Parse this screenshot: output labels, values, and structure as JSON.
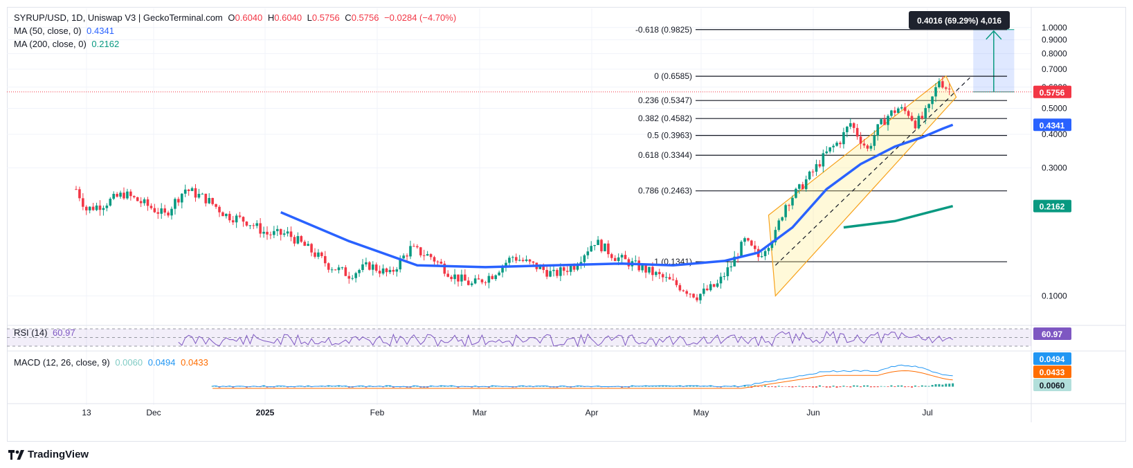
{
  "header": {
    "symbol": "SYRUP/USD, 1D, Uniswap V3 | GeckoTerminal.com",
    "o_label": "O",
    "o": "0.6040",
    "h_label": "H",
    "h": "0.6040",
    "l_label": "L",
    "l": "0.5756",
    "c_label": "C",
    "c": "0.5756",
    "change": "−0.0284 (−4.70%)"
  },
  "ma50": {
    "label": "MA (50, close, 0)",
    "value": "0.4341"
  },
  "ma200": {
    "label": "MA (200, close, 0)",
    "value": "0.2162"
  },
  "rsi": {
    "label": "RSI (14)",
    "value": "60.97"
  },
  "macd": {
    "label": "MACD (12, 26, close, 9)",
    "hist": "0.0060",
    "macd": "0.0494",
    "signal": "0.0433"
  },
  "measure_tooltip": "0.4016 (69.29%) 4,016",
  "brand": "TradingView",
  "colors": {
    "up": "#089981",
    "down": "#f23645",
    "ma50": "#2962ff",
    "ma200": "#089981",
    "rsi": "#7e57c2",
    "macd_line": "#2196f3",
    "signal_line": "#ff6d00",
    "channel": "#f7a21b"
  },
  "chart_data": {
    "type": "candlestick",
    "title": "SYRUP/USD, 1D, Uniswap V3",
    "x_ticks": [
      "13",
      "Dec",
      "2025",
      "Feb",
      "Mar",
      "Apr",
      "May",
      "Jun",
      "Jul"
    ],
    "y_ticks": [
      "1.0000",
      "0.9000",
      "0.8000",
      "0.7000",
      "0.6000",
      "0.5000",
      "0.4000",
      "0.3000",
      "0.1000"
    ],
    "y_tick_values": [
      1.0,
      0.9,
      0.8,
      0.7,
      0.6,
      0.5,
      0.4,
      0.3,
      0.1
    ],
    "last_price": "0.5756",
    "fib_levels": [
      {
        "label": "-0.618 (0.9825)",
        "value": 0.9825
      },
      {
        "label": "0 (0.6585)",
        "value": 0.6585
      },
      {
        "label": "0.236 (0.5347)",
        "value": 0.5347
      },
      {
        "label": "0.382 (0.4582)",
        "value": 0.4582
      },
      {
        "label": "0.5 (0.3963)",
        "value": 0.3963
      },
      {
        "label": "0.618 (0.3344)",
        "value": 0.3344
      },
      {
        "label": "0.786 (0.2463)",
        "value": 0.2463
      },
      {
        "label": "1 (0.1341)",
        "value": 0.1341
      }
    ],
    "price_labels": [
      {
        "text": "0.5756",
        "value": 0.5756,
        "color": "#f23645"
      },
      {
        "text": "0.4341",
        "value": 0.4341,
        "color": "#2962ff"
      },
      {
        "text": "0.2162",
        "value": 0.2162,
        "color": "#089981"
      }
    ],
    "macd_labels": [
      {
        "text": "0.0494",
        "color": "#2196f3"
      },
      {
        "text": "0.0433",
        "color": "#ff6d00"
      },
      {
        "text": "0.0060",
        "color": "#b2dfdb"
      }
    ],
    "candle_anchors": [
      [
        0,
        0.25
      ],
      [
        3,
        0.21
      ],
      [
        8,
        0.22
      ],
      [
        14,
        0.24
      ],
      [
        20,
        0.22
      ],
      [
        26,
        0.2
      ],
      [
        32,
        0.25
      ],
      [
        38,
        0.23
      ],
      [
        44,
        0.2
      ],
      [
        50,
        0.19
      ],
      [
        56,
        0.17
      ],
      [
        62,
        0.17
      ],
      [
        68,
        0.15
      ],
      [
        74,
        0.13
      ],
      [
        80,
        0.12
      ],
      [
        86,
        0.13
      ],
      [
        92,
        0.12
      ],
      [
        98,
        0.15
      ],
      [
        104,
        0.14
      ],
      [
        110,
        0.12
      ],
      [
        116,
        0.11
      ],
      [
        122,
        0.12
      ],
      [
        128,
        0.14
      ],
      [
        134,
        0.13
      ],
      [
        140,
        0.12
      ],
      [
        146,
        0.13
      ],
      [
        152,
        0.16
      ],
      [
        158,
        0.14
      ],
      [
        164,
        0.13
      ],
      [
        170,
        0.12
      ],
      [
        176,
        0.11
      ],
      [
        182,
        0.1
      ],
      [
        188,
        0.11
      ],
      [
        192,
        0.13
      ],
      [
        196,
        0.16
      ],
      [
        200,
        0.14
      ],
      [
        205,
        0.17
      ],
      [
        208,
        0.22
      ],
      [
        212,
        0.25
      ],
      [
        216,
        0.29
      ],
      [
        220,
        0.34
      ],
      [
        224,
        0.38
      ],
      [
        227,
        0.44
      ],
      [
        229,
        0.4
      ],
      [
        232,
        0.35
      ],
      [
        235,
        0.42
      ],
      [
        238,
        0.47
      ],
      [
        241,
        0.5
      ],
      [
        244,
        0.48
      ],
      [
        246,
        0.44
      ],
      [
        248,
        0.46
      ],
      [
        250,
        0.5
      ],
      [
        252,
        0.59
      ],
      [
        253,
        0.64
      ],
      [
        255,
        0.6
      ],
      [
        257,
        0.5756
      ]
    ],
    "ma50_points": [
      [
        60,
        0.205
      ],
      [
        80,
        0.16
      ],
      [
        100,
        0.13
      ],
      [
        120,
        0.128
      ],
      [
        140,
        0.13
      ],
      [
        160,
        0.132
      ],
      [
        175,
        0.13
      ],
      [
        190,
        0.135
      ],
      [
        200,
        0.145
      ],
      [
        210,
        0.18
      ],
      [
        220,
        0.25
      ],
      [
        230,
        0.31
      ],
      [
        240,
        0.36
      ],
      [
        248,
        0.39
      ],
      [
        254,
        0.42
      ],
      [
        257,
        0.4341
      ]
    ],
    "ma200_points": [
      [
        225,
        0.18
      ],
      [
        240,
        0.19
      ],
      [
        250,
        0.205
      ],
      [
        257,
        0.2162
      ]
    ],
    "channel": {
      "upper": [
        [
          203,
          0.2
        ],
        [
          255,
          0.66
        ]
      ],
      "lower": [
        [
          205,
          0.1
        ],
        [
          258,
          0.55
        ]
      ]
    },
    "trend_dashed": [
      [
        205,
        0.13
      ],
      [
        262,
        0.65
      ]
    ],
    "measure": {
      "from_price": 0.5756,
      "to_price": 0.9825,
      "x_from": 263,
      "x_to": 275
    },
    "rsi_values_hint": "oscillates between 40 and 70, last 60.97",
    "x_domain": [
      0,
      280
    ],
    "y_domain_log": [
      0.08,
      1.06
    ]
  }
}
